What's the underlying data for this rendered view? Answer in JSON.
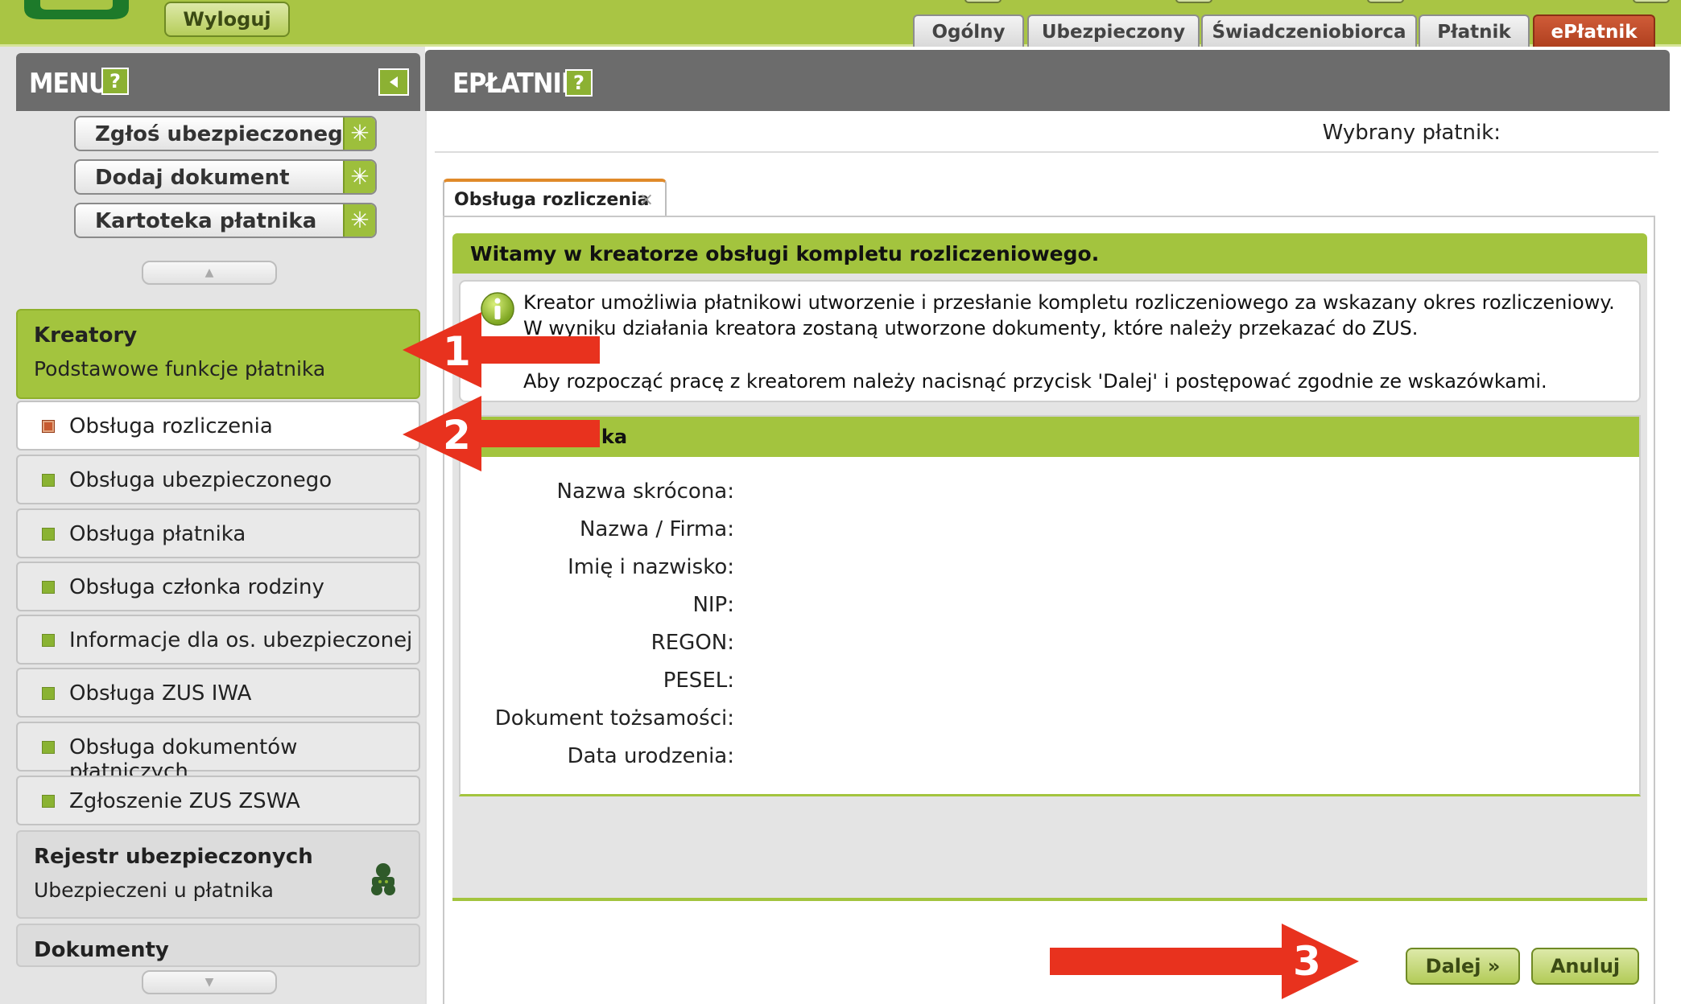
{
  "header": {
    "logout_label": "Wyloguj",
    "tabs": [
      {
        "label": "Ogólny"
      },
      {
        "label": "Ubezpieczony"
      },
      {
        "label": "Świadczeniobiorca"
      },
      {
        "label": "Płatnik"
      },
      {
        "label": "ePłatnik",
        "active": true
      }
    ]
  },
  "menu": {
    "title": "MENU",
    "help_label": "?",
    "quick_actions": [
      {
        "label": "Zgłoś ubezpieczonego"
      },
      {
        "label": "Dodaj dokument"
      },
      {
        "label": "Kartoteka płatnika"
      }
    ],
    "sections": {
      "kreatory": {
        "title": "Kreatory",
        "subtitle": "Podstawowe funkcje płatnika"
      },
      "rejestr": {
        "title": "Rejestr ubezpieczonych",
        "subtitle": "Ubezpieczeni u płatnika"
      },
      "dokumenty": {
        "title": "Dokumenty"
      }
    },
    "items": [
      {
        "label": "Obsługa rozliczenia",
        "selected": true
      },
      {
        "label": "Obsługa ubezpieczonego"
      },
      {
        "label": "Obsługa płatnika"
      },
      {
        "label": "Obsługa członka rodziny"
      },
      {
        "label": "Informacje dla os. ubezpieczonej"
      },
      {
        "label": "Obsługa ZUS IWA"
      },
      {
        "label": "Obsługa dokumentów płatniczych"
      },
      {
        "label": "Zgłoszenie ZUS ZSWA"
      }
    ]
  },
  "content": {
    "title": "EPŁATNIK",
    "help_label": "?",
    "selected_payer_label": "Wybrany płatnik:",
    "doc_tab": {
      "label": "Obsługa rozliczenia",
      "close": "×"
    },
    "welcome": "Witamy w kreatorze obsługi kompletu rozliczeniowego.",
    "info": {
      "line1": "Kreator umożliwia płatnikowi utworzenie i przesłanie kompletu rozliczeniowego za wskazany okres rozliczeniowy.",
      "line2": "W wyniku działania kreatora zostaną utworzone dokumenty, które należy przekazać do ZUS.",
      "line3": "Aby rozpocząć pracę z kreatorem należy nacisnąć przycisk 'Dalej' i postępować zgodnie ze wskazówkami."
    },
    "dane": {
      "title": "Dane płatnika",
      "fields": [
        {
          "label": "Nazwa skrócona:"
        },
        {
          "label": "Nazwa / Firma:"
        },
        {
          "label": "Imię i nazwisko:"
        },
        {
          "label": "NIP:"
        },
        {
          "label": "REGON:"
        },
        {
          "label": "PESEL:"
        },
        {
          "label": "Dokument tożsamości:"
        },
        {
          "label": "Data urodzenia:"
        }
      ]
    },
    "buttons": {
      "next": "Dalej »",
      "cancel": "Anuluj"
    }
  },
  "annotations": [
    {
      "number": "1"
    },
    {
      "number": "2"
    },
    {
      "number": "3"
    }
  ],
  "colors": {
    "brand_green": "#a3c43e",
    "active_tab": "#c0492a",
    "header_gray": "#6c6c6c",
    "annotation_red": "#e8321e"
  }
}
